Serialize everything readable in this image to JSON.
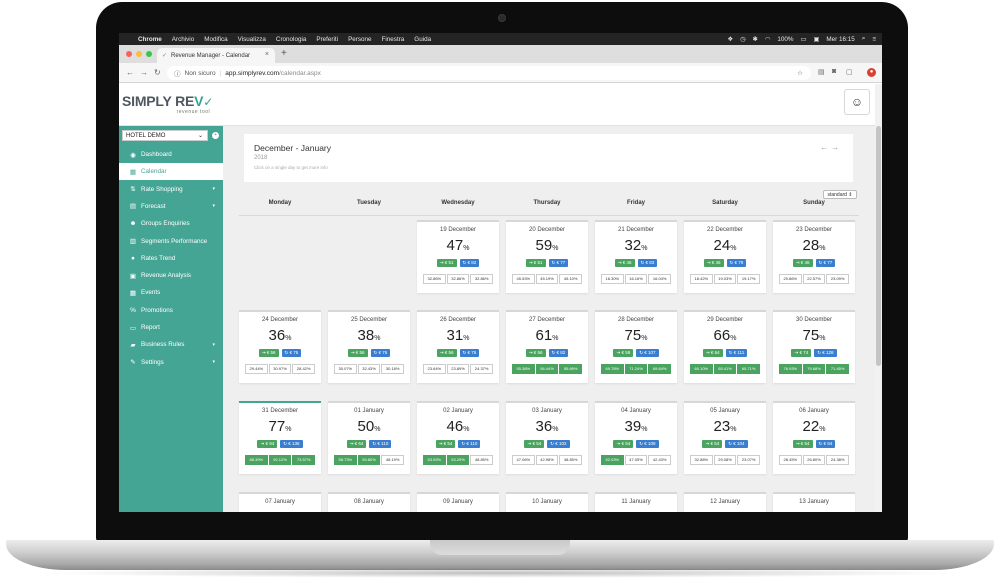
{
  "menubar": {
    "apple": "",
    "items": [
      "Chrome",
      "Archivio",
      "Modifica",
      "Visualizza",
      "Cronologia",
      "Preferiti",
      "Persone",
      "Finestra",
      "Guida"
    ],
    "battery": "100%",
    "clock": "Mer 16:15"
  },
  "browser": {
    "tab_title": "Revenue Manager - Calendar",
    "new_tab": "+",
    "security": "Non sicuro",
    "url_host": "app.simplyrev.com",
    "url_path": "/calendar.aspx"
  },
  "app": {
    "logo_main": "SIMPLY RE",
    "logo_accent": "V",
    "logo_tagline": "revenue tool",
    "hotel_selector": "HOTEL DEMO"
  },
  "sidebar": {
    "items": [
      {
        "label": "Dashboard",
        "icon": "dashboard-icon",
        "glyph": "◉",
        "arrow": ""
      },
      {
        "label": "Calendar",
        "icon": "calendar-icon",
        "glyph": "▦",
        "arrow": ""
      },
      {
        "label": "Rate Shopping",
        "icon": "rate-shopping-icon",
        "glyph": "⇅",
        "arrow": "▾"
      },
      {
        "label": "Forecast",
        "icon": "forecast-icon",
        "glyph": "▤",
        "arrow": "▾"
      },
      {
        "label": "Groups Enquiries",
        "icon": "groups-icon",
        "glyph": "☻",
        "arrow": ""
      },
      {
        "label": "Segments Performance",
        "icon": "segments-icon",
        "glyph": "▥",
        "arrow": ""
      },
      {
        "label": "Rates Trend",
        "icon": "rates-trend-icon",
        "glyph": "●",
        "arrow": ""
      },
      {
        "label": "Revenue Analysis",
        "icon": "revenue-analysis-icon",
        "glyph": "▣",
        "arrow": ""
      },
      {
        "label": "Events",
        "icon": "events-icon",
        "glyph": "▦",
        "arrow": ""
      },
      {
        "label": "Promotions",
        "icon": "promotions-icon",
        "glyph": "%",
        "arrow": ""
      },
      {
        "label": "Report",
        "icon": "report-icon",
        "glyph": "▭",
        "arrow": ""
      },
      {
        "label": "Business Rules",
        "icon": "business-rules-icon",
        "glyph": "▰",
        "arrow": "▾"
      },
      {
        "label": "Settings",
        "icon": "settings-icon",
        "glyph": "✎",
        "arrow": "▾"
      }
    ]
  },
  "calendar": {
    "title": "December - January",
    "year": "2018",
    "hint": "Click on a single day to get more info",
    "view_select": "standard ⇕",
    "weekdays": [
      "Monday",
      "Tuesday",
      "Wednesday",
      "Thursday",
      "Friday",
      "Saturday",
      "Sunday"
    ],
    "occ_unit": "%",
    "weeks": [
      [
        null,
        null,
        {
          "date": "19 December",
          "occ": "47",
          "rates": [
            "⇥ € 51",
            "↻ € 82"
          ],
          "pcts": [
            "32.86%",
            "32.86%",
            "32.86%"
          ],
          "hi": []
        },
        {
          "date": "20 December",
          "occ": "59",
          "rates": [
            "⇥ € 51",
            "↻ € 77"
          ],
          "pcts": [
            "45.53%",
            "45.19%",
            "45.10%"
          ],
          "hi": []
        },
        {
          "date": "21 December",
          "occ": "32",
          "rates": [
            "⇥ € 46",
            "↻ € 83"
          ],
          "pcts": [
            "16.30%",
            "16.16%",
            "16.04%"
          ],
          "hi": []
        },
        {
          "date": "22 December",
          "occ": "24",
          "rates": [
            "⇥ € 46",
            "↻ € 79"
          ],
          "pcts": [
            "18.42%",
            "19.03%",
            "19.17%"
          ],
          "hi": []
        },
        {
          "date": "23 December",
          "occ": "28",
          "rates": [
            "⇥ € 46",
            "↻ € 77"
          ],
          "pcts": [
            "20.86%",
            "22.57%",
            "23.09%"
          ],
          "hi": []
        }
      ],
      [
        {
          "date": "24 December",
          "occ": "36",
          "rates": [
            "⇥ € 56",
            "↻ € 75"
          ],
          "pcts": [
            "29.44%",
            "30.97%",
            "28.42%"
          ],
          "hi": []
        },
        {
          "date": "25 December",
          "occ": "38",
          "rates": [
            "⇥ € 56",
            "↻ € 76"
          ],
          "pcts": [
            "30.07%",
            "32.43%",
            "30.18%"
          ],
          "hi": []
        },
        {
          "date": "26 December",
          "occ": "31",
          "rates": [
            "⇥ € 56",
            "↻ € 76"
          ],
          "pcts": [
            "23.64%",
            "23.89%",
            "24.37%"
          ],
          "hi": []
        },
        {
          "date": "27 December",
          "occ": "61",
          "rates": [
            "⇥ € 56",
            "↻ € 82"
          ],
          "pcts": [
            "55.38%",
            "56.44%",
            "55.69%"
          ],
          "hi": [
            0,
            1,
            2
          ]
        },
        {
          "date": "28 December",
          "occ": "75",
          "rates": [
            "⇥ € 59",
            "↻ € 107"
          ],
          "pcts": [
            "69.78%",
            "71.24%",
            "69.64%"
          ],
          "hi": [
            0,
            1,
            2
          ]
        },
        {
          "date": "29 December",
          "occ": "66",
          "rates": [
            "⇥ € 64",
            "↻ € 111"
          ],
          "pcts": [
            "60.10%",
            "65.41%",
            "65.71%"
          ],
          "hi": [
            0,
            1,
            2
          ]
        },
        {
          "date": "30 December",
          "occ": "75",
          "rates": [
            "⇥ € 74",
            "↻ € 128"
          ],
          "pcts": [
            "76.93%",
            "79.68%",
            "71.45%"
          ],
          "hi": [
            0,
            1,
            2
          ]
        }
      ],
      [
        {
          "date": "31 December",
          "occ": "77",
          "rates": [
            "⇥ € 94",
            "↻ € 136"
          ],
          "pcts": [
            "88.39%",
            "92.12%",
            "73.57%"
          ],
          "hi": [
            0,
            1,
            2
          ],
          "today": true
        },
        {
          "date": "01 January",
          "occ": "50",
          "rates": [
            "⇥ € 64",
            "↻ € 110"
          ],
          "pcts": [
            "58.73%",
            "59.80%",
            "48.19%"
          ],
          "hi": [
            0,
            1
          ]
        },
        {
          "date": "02 January",
          "occ": "46",
          "rates": [
            "⇥ € 54",
            "↻ € 110"
          ],
          "pcts": [
            "53.93%",
            "53.29%",
            "48.85%"
          ],
          "hi": [
            0,
            1
          ]
        },
        {
          "date": "03 January",
          "occ": "36",
          "rates": [
            "⇥ € 54",
            "↻ € 102"
          ],
          "pcts": [
            "47.06%",
            "42.98%",
            "38.85%"
          ],
          "hi": []
        },
        {
          "date": "04 January",
          "occ": "39",
          "rates": [
            "⇥ € 54",
            "↻ € 109"
          ],
          "pcts": [
            "52.03%",
            "47.05%",
            "42.43%"
          ],
          "hi": [
            0
          ]
        },
        {
          "date": "05 January",
          "occ": "23",
          "rates": [
            "⇥ € 54",
            "↻ € 104"
          ],
          "pcts": [
            "32.88%",
            "29.08%",
            "23.07%"
          ],
          "hi": []
        },
        {
          "date": "06 January",
          "occ": "22",
          "rates": [
            "⇥ € 54",
            "↻ € 94"
          ],
          "pcts": [
            "28.45%",
            "26.80%",
            "24.38%"
          ],
          "hi": []
        }
      ],
      [
        {
          "date": "07 January"
        },
        {
          "date": "08 January"
        },
        {
          "date": "09 January"
        },
        {
          "date": "10 January"
        },
        {
          "date": "11 January"
        },
        {
          "date": "12 January"
        },
        {
          "date": "13 January"
        }
      ]
    ]
  },
  "colors": {
    "brand": "#45a594",
    "rate_green": "#4aa35f",
    "rate_blue": "#3a7fcf"
  }
}
